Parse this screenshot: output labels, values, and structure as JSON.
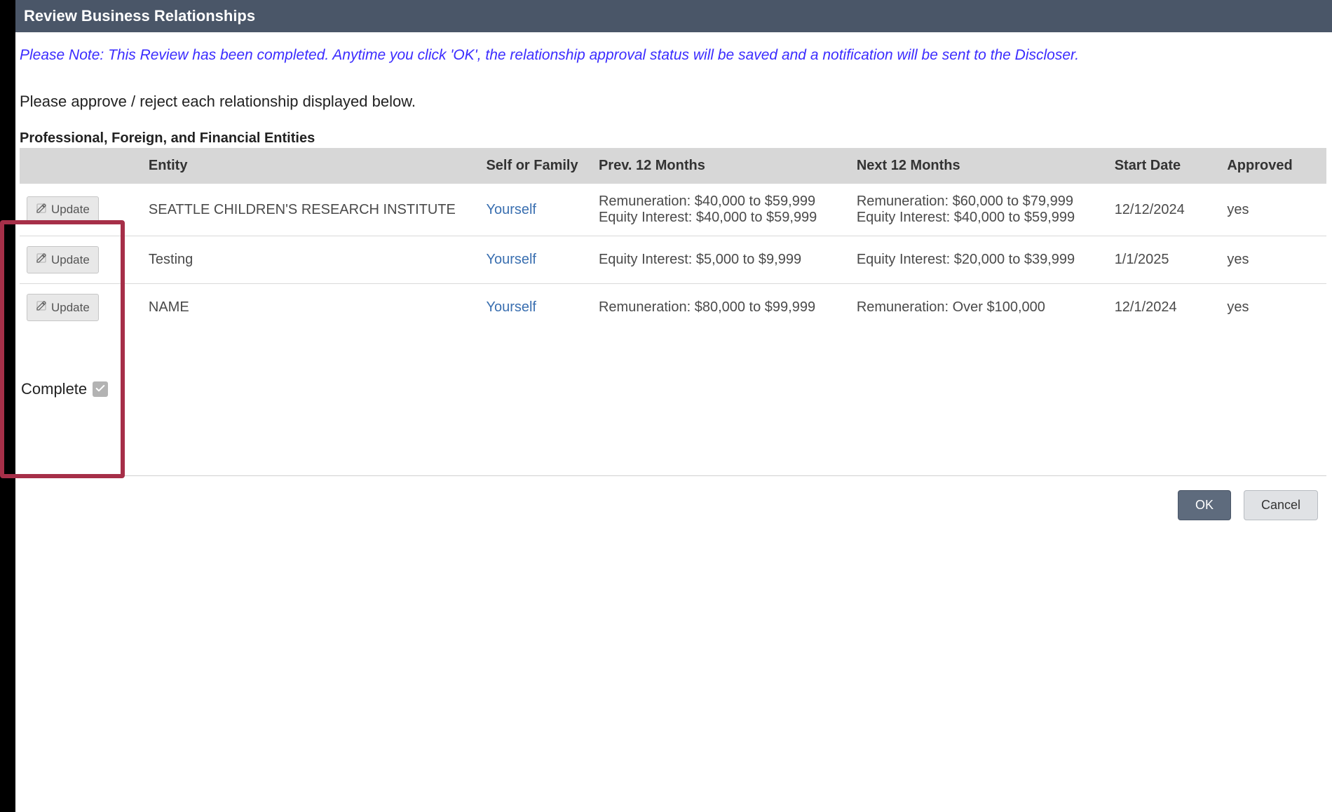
{
  "header": {
    "title": "Review Business Relationships"
  },
  "note": "Please Note: This Review has been completed. Anytime you click 'OK', the relationship approval status will be saved and a notification will be sent to the Discloser.",
  "instruction": "Please approve / reject each relationship displayed below.",
  "section_title": "Professional, Foreign, and Financial Entities",
  "columns": {
    "entity": "Entity",
    "self": "Self or Family",
    "prev": "Prev. 12 Months",
    "next": "Next 12 Months",
    "start": "Start Date",
    "approved": "Approved"
  },
  "update_label": "Update",
  "rows": [
    {
      "entity": "SEATTLE CHILDREN'S RESEARCH INSTITUTE",
      "self": "Yourself",
      "prev": "Remuneration: $40,000 to $59,999\nEquity Interest: $40,000 to $59,999",
      "next": "Remuneration: $60,000 to $79,999\nEquity Interest: $40,000 to $59,999",
      "start": "12/12/2024",
      "approved": "yes"
    },
    {
      "entity": "Testing",
      "self": "Yourself",
      "prev": "Equity Interest: $5,000 to $9,999",
      "next": "Equity Interest: $20,000 to $39,999",
      "start": "1/1/2025",
      "approved": "yes"
    },
    {
      "entity": "NAME",
      "self": "Yourself",
      "prev": "Remuneration: $80,000 to $99,999",
      "next": "Remuneration: Over $100,000",
      "start": "12/1/2024",
      "approved": "yes"
    }
  ],
  "complete_label": "Complete",
  "footer": {
    "ok": "OK",
    "cancel": "Cancel"
  }
}
